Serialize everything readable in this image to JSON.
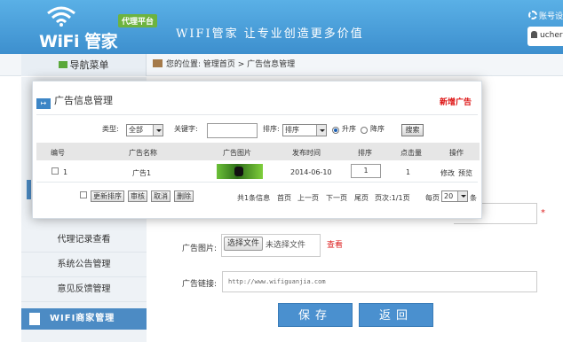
{
  "header": {
    "logo_text": "WiFi 管家",
    "badge": "代理平台",
    "slogan": "WIFI管家 让专业创造更多价值",
    "account_label": "账号设",
    "user_name": "ucher"
  },
  "nav": {
    "menu_label": "导航菜单",
    "breadcrumb": "您的位置: 管理首页 > 广告信息管理"
  },
  "sidebar": {
    "items": [
      {
        "label": "代理记录查看"
      },
      {
        "label": "系统公告管理"
      },
      {
        "label": "意见反馈管理"
      }
    ],
    "section_label": "WIFI商家管理"
  },
  "form": {
    "image_label": "广告图片:",
    "file_button": "选择文件",
    "file_status": "未选择文件",
    "view_link": "查看",
    "link_label": "广告链接:",
    "link_value": "http://www.wifiguanjia.com",
    "required_mark": "*",
    "save_button": "保存",
    "back_button": "返回"
  },
  "modal": {
    "title": "广告信息管理",
    "add_link": "新增广告",
    "filters": {
      "type_label": "类型:",
      "type_value": "全部",
      "keyword_label": "关键字:",
      "keyword_value": "",
      "sort_label": "排序:",
      "sort_value": "排序",
      "asc_label": "升序",
      "desc_label": "降序",
      "asc_selected": true,
      "search_button": "搜索"
    },
    "columns": [
      "编号",
      "广告名称",
      "广告图片",
      "发布时间",
      "排序",
      "点击量",
      "操作"
    ],
    "rows": [
      {
        "id": "1",
        "name": "广告1",
        "date": "2014-06-10",
        "sort": "1",
        "clicks": "1",
        "actions": [
          "修改",
          "预览"
        ]
      }
    ],
    "footer": {
      "update_sort": "更新排序",
      "approve": "审核",
      "cancel": "取消",
      "delete": "删除",
      "total": "共1条信息",
      "first": "首页",
      "prev": "上一页",
      "next": "下一页",
      "last": "尾页",
      "page_info": "页次:1/1页",
      "per_page_label": "每页",
      "per_page_value": "20",
      "per_page_unit": "条"
    }
  },
  "colors": {
    "header_blue": "#3d8fce",
    "accent_red": "#d11111",
    "sidebar_section": "#4c8bc4",
    "badge_green": "#6db33f"
  }
}
